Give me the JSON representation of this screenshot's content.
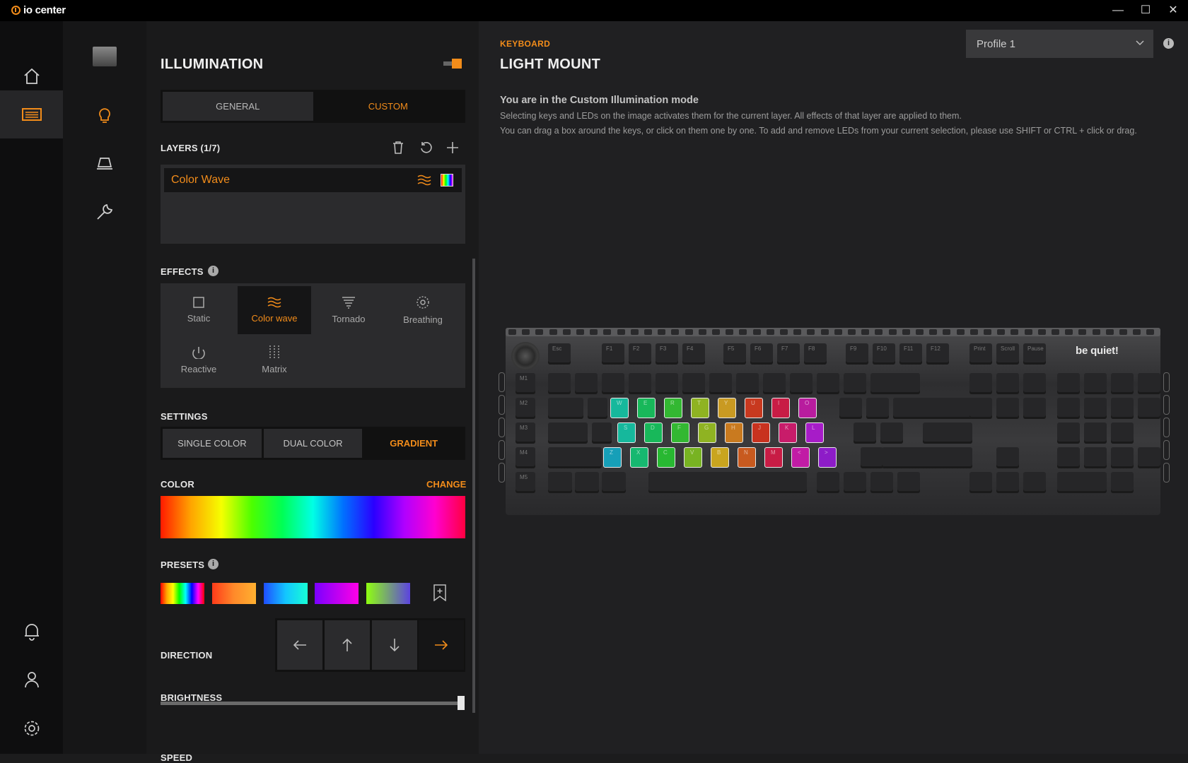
{
  "app": {
    "name": "io center"
  },
  "window": {
    "minimize": "—",
    "maximize": "☐",
    "close": "✕"
  },
  "accent": "#f28c1a",
  "nav_rail": {
    "items": [
      "home-icon",
      "keyboard-icon",
      "bell-icon",
      "user-icon",
      "settings-icon"
    ],
    "active": "keyboard-icon"
  },
  "sub_nav": {
    "items": [
      "keyboard-thumbnail",
      "lightbulb-icon",
      "light-mount-icon",
      "wrench-icon"
    ],
    "active": "lightbulb-icon"
  },
  "panel": {
    "title": "ILLUMINATION",
    "tabs": [
      {
        "label": "GENERAL"
      },
      {
        "label": "CUSTOM"
      }
    ],
    "active_tab": "CUSTOM",
    "layers": {
      "label": "LAYERS (1/7)",
      "items": [
        {
          "name": "Color Wave"
        }
      ]
    },
    "effects": {
      "label": "EFFECTS",
      "items": [
        {
          "label": "Static",
          "icon": "square-icon"
        },
        {
          "label": "Color wave",
          "icon": "wave-icon"
        },
        {
          "label": "Tornado",
          "icon": "tornado-icon"
        },
        {
          "label": "Breathing",
          "icon": "breathing-icon"
        },
        {
          "label": "Reactive",
          "icon": "reactive-icon"
        },
        {
          "label": "Matrix",
          "icon": "matrix-icon"
        }
      ],
      "active": "Color wave"
    },
    "settings": {
      "label": "SETTINGS",
      "options": [
        "SINGLE COLOR",
        "DUAL COLOR",
        "GRADIENT"
      ],
      "active": "GRADIENT"
    },
    "color": {
      "label": "COLOR",
      "change_label": "CHANGE"
    },
    "presets": {
      "label": "PRESETS",
      "colors": [
        "linear-gradient(90deg,#ff0000,#ffa500,#ffff00,#00ff00,#00ffff,#0000ff,#ff00ff,#ff0000)",
        "linear-gradient(90deg,#ff3b1a,#ff8a2a,#ffb030)",
        "linear-gradient(90deg,#1f4dff,#13c6ff,#17ffd5)",
        "linear-gradient(90deg,#7a00ff,#ff00e6)",
        "linear-gradient(90deg,#8fff10,#5c43e0)"
      ]
    },
    "direction": {
      "label": "DIRECTION",
      "options": [
        "←",
        "↑",
        "↓",
        "→"
      ],
      "active": "→"
    },
    "brightness": {
      "label": "BRIGHTNESS",
      "value": 1.0
    },
    "speed": {
      "label": "SPEED"
    }
  },
  "main": {
    "section": "KEYBOARD",
    "title": "LIGHT MOUNT",
    "profile": "Profile 1",
    "heading": "You are in the Custom Illumination mode",
    "desc1": "Selecting keys and LEDs on the image activates them for the current layer. All effects of that layer are applied to them.",
    "desc2": "You can drag a box around the keys, or click on them one by one. To add and remove LEDs from your current selection, please use SHIFT or CTRL + click or drag.",
    "brand": "be quiet!",
    "keyboard": {
      "fn_row": [
        "Esc",
        "F1",
        "F2",
        "F3",
        "F4",
        "F5",
        "F6",
        "F7",
        "F8",
        "F9",
        "F10",
        "F11",
        "F12",
        "Print",
        "Scroll",
        "Pause"
      ],
      "rows_labels": [
        "M1",
        "M2",
        "M3",
        "M4",
        "M5"
      ],
      "lit_rows": [
        {
          "keys": [
            "W",
            "E",
            "R",
            "T",
            "Y",
            "U",
            "I",
            "O"
          ],
          "colors": [
            "#16b89c",
            "#18b85a",
            "#33b832",
            "#8fb322",
            "#c99a22",
            "#c8391f",
            "#c81c45",
            "#b81c9e"
          ]
        },
        {
          "keys": [
            "S",
            "D",
            "F",
            "G",
            "H",
            "J",
            "K",
            "L"
          ],
          "colors": [
            "#16b89c",
            "#18b85a",
            "#33b832",
            "#8fb322",
            "#c97a1f",
            "#c8321f",
            "#c81c6a",
            "#a71cc8"
          ]
        },
        {
          "keys": [
            "Z",
            "X",
            "C",
            "V",
            "B",
            "N",
            "M",
            "<",
            ">"
          ],
          "colors": [
            "#169fb8",
            "#16b870",
            "#28b832",
            "#78b322",
            "#c9a51f",
            "#c85a1f",
            "#c81c45",
            "#c11ca5",
            "#8d1cc8"
          ]
        }
      ]
    }
  }
}
